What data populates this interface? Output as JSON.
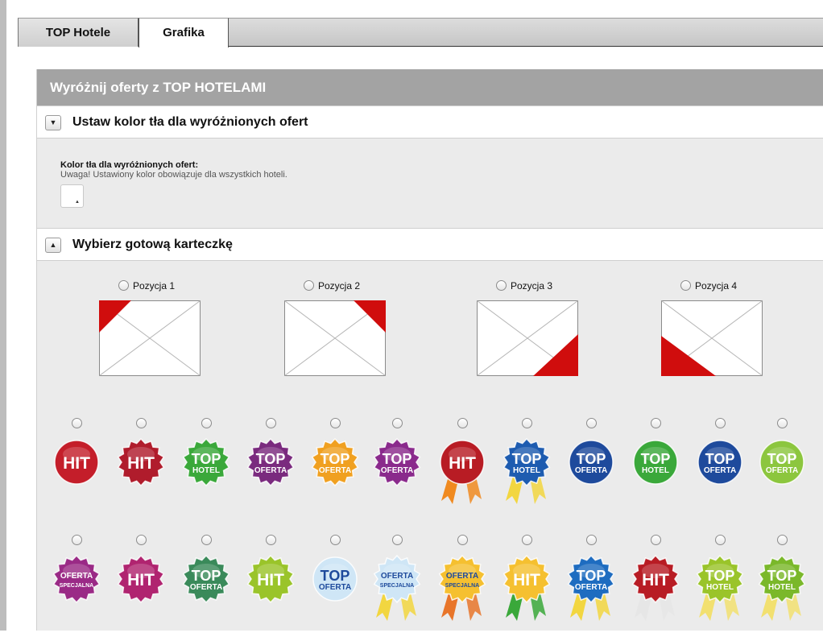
{
  "tabs": [
    {
      "label": "TOP Hotele"
    },
    {
      "label": "Grafika"
    }
  ],
  "panel": {
    "title": "Wyróżnij oferty z TOP HOTELAMI"
  },
  "background_section": {
    "toggle_symbol": "▼",
    "title": "Ustaw kolor tła dla wyróżnionych ofert",
    "field_label": "Kolor tła dla wyróżnionych ofert:",
    "note": "Uwaga! Ustawiony kolor obowiązuje dla wszystkich hoteli.",
    "swatch_color": "#ffffff",
    "swatch_arrow": "▲"
  },
  "card_section": {
    "toggle_symbol": "▲",
    "title": "Wybierz gotową karteczkę",
    "positions": [
      {
        "label": "Pozycja 1",
        "corner": "top-left"
      },
      {
        "label": "Pozycja 2",
        "corner": "top-right"
      },
      {
        "label": "Pozycja 3",
        "corner": "bottom-right"
      },
      {
        "label": "Pozycja 4",
        "corner": "bottom-left"
      }
    ],
    "accent_color": "#d00d0d"
  },
  "badges_row1": [
    {
      "line1": "HIT",
      "line2": "",
      "shape": "circle",
      "color": "#c41e2a",
      "ribbon": false
    },
    {
      "line1": "HIT",
      "line2": "",
      "shape": "star",
      "color": "#b01c2c",
      "ribbon": false
    },
    {
      "line1": "TOP",
      "line2": "HOTEL",
      "shape": "star",
      "color": "#3aa83a",
      "ribbon": false
    },
    {
      "line1": "TOP",
      "line2": "OFERTA",
      "shape": "star",
      "color": "#7a2a7e",
      "ribbon": false
    },
    {
      "line1": "TOP",
      "line2": "OFERTA",
      "shape": "star",
      "color": "#f0a020",
      "ribbon": false
    },
    {
      "line1": "TOP",
      "line2": "OFERTA",
      "shape": "star",
      "color": "#8a2a8c",
      "ribbon": false
    },
    {
      "line1": "HIT",
      "line2": "",
      "shape": "circle",
      "color": "#b81c24",
      "ribbon": true,
      "ribbon_color": "#f08a20"
    },
    {
      "line1": "TOP",
      "line2": "HOTEL",
      "shape": "star",
      "color": "#1e5cb0",
      "ribbon": true,
      "ribbon_color": "#f2d640"
    },
    {
      "line1": "TOP",
      "line2": "OFERTA",
      "shape": "circle",
      "color": "#1e4a9c",
      "ribbon": false
    },
    {
      "line1": "TOP",
      "line2": "HOTEL",
      "shape": "circle",
      "color": "#3aa83a",
      "ribbon": false
    },
    {
      "line1": "TOP",
      "line2": "OFERTA",
      "shape": "circle",
      "color": "#1e4a9c",
      "ribbon": false
    },
    {
      "line1": "TOP",
      "line2": "OFERTA",
      "shape": "circle",
      "color": "#8cc63e",
      "ribbon": false
    }
  ],
  "badges_row2": [
    {
      "line1": "OFERTA",
      "line2": "SPECJALNA",
      "shape": "star",
      "color": "#9a2a86",
      "ribbon": false
    },
    {
      "line1": "HIT",
      "line2": "",
      "shape": "star",
      "color": "#b02470",
      "ribbon": false
    },
    {
      "line1": "TOP",
      "line2": "OFERTA",
      "shape": "star",
      "color": "#3a8a5a",
      "ribbon": false
    },
    {
      "line1": "HIT",
      "line2": "",
      "shape": "star",
      "color": "#9ac42a",
      "ribbon": false
    },
    {
      "line1": "TOP",
      "line2": "OFERTA",
      "shape": "circle",
      "color": "#cfe6f6",
      "dark_text": true,
      "ribbon": false
    },
    {
      "line1": "OFERTA",
      "line2": "SPECJALNA",
      "shape": "star",
      "color": "#cfe6f6",
      "dark_text": true,
      "ribbon": true,
      "ribbon_color": "#f2d640"
    },
    {
      "line1": "OFERTA",
      "line2": "SPECJALNA",
      "shape": "star",
      "color": "#f5c030",
      "dark_text": true,
      "ribbon": true,
      "ribbon_color": "#e8752a"
    },
    {
      "line1": "HIT",
      "line2": "",
      "shape": "star",
      "color": "#f5c030",
      "ribbon": true,
      "ribbon_color": "#3aa83a"
    },
    {
      "line1": "TOP",
      "line2": "OFERTA",
      "shape": "star",
      "color": "#1e6cc0",
      "ribbon": true,
      "ribbon_color": "#f2d640"
    },
    {
      "line1": "HIT",
      "line2": "",
      "shape": "star",
      "color": "#b81c24",
      "ribbon": true,
      "ribbon_color": "#e6e6e6"
    },
    {
      "line1": "TOP",
      "line2": "HOTEL",
      "shape": "star",
      "color": "#9ac42a",
      "ribbon": true,
      "ribbon_color": "#f2e070"
    },
    {
      "line1": "TOP",
      "line2": "HOTEL",
      "shape": "star",
      "color": "#7ab82a",
      "ribbon": true,
      "ribbon_color": "#f2e070"
    }
  ]
}
